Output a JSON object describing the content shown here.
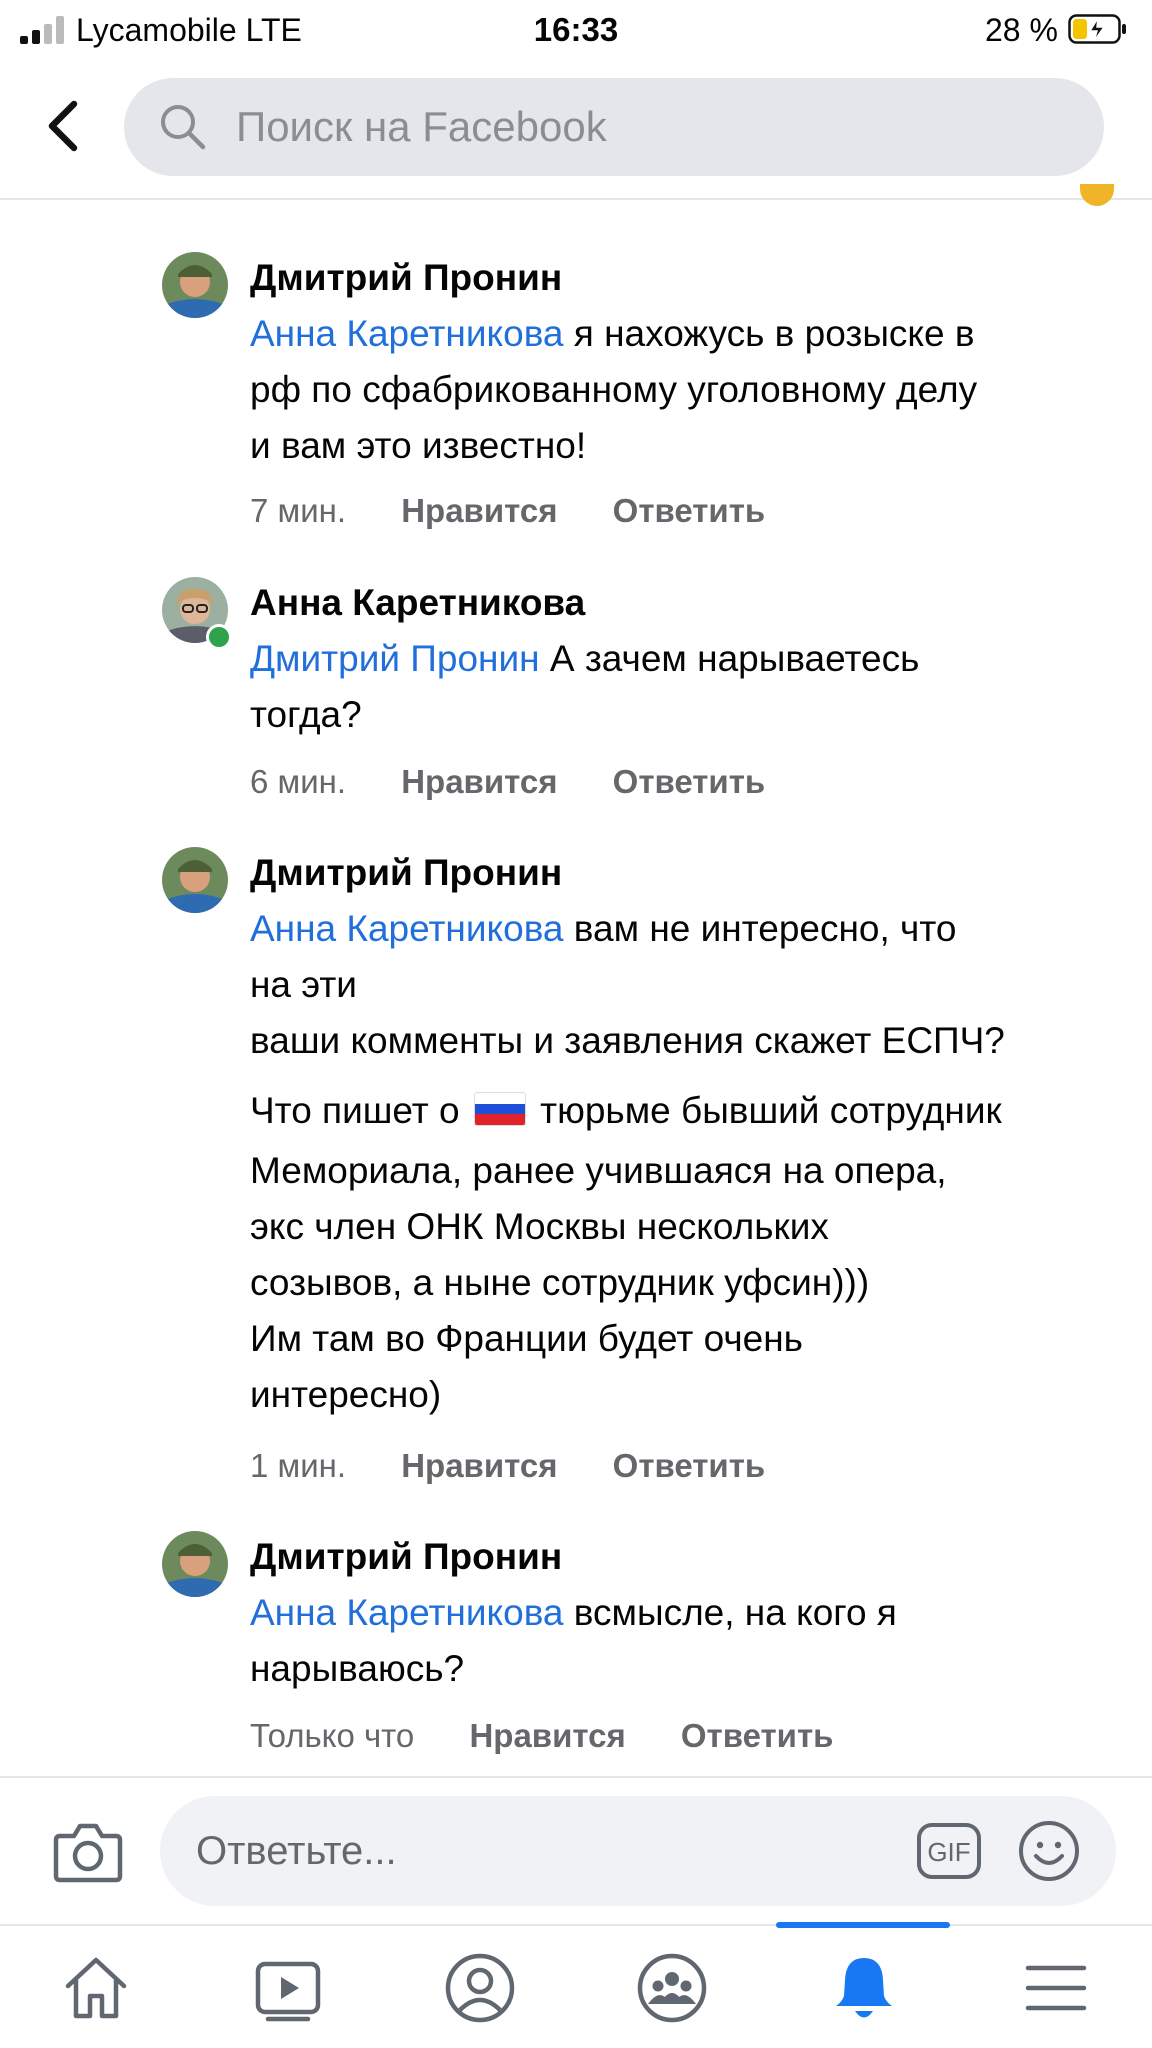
{
  "status_bar": {
    "carrier": "Lycamobile  LTE",
    "time": "16:33",
    "battery": "28 %",
    "battery_level": 0.28
  },
  "header": {
    "search_placeholder": "Поиск на Facebook"
  },
  "comments": [
    {
      "author": "Дмитрий Пронин",
      "lines": [
        {
          "mention": "Анна Каретникова",
          "text": " я нахожусь в розыске в"
        },
        {
          "text": "рф по сфабрикованному уголовному делу"
        },
        {
          "text": "и вам это известно!"
        }
      ],
      "time": "7 мин.",
      "like": "Нравится",
      "reply": "Ответить"
    },
    {
      "author": "Анна Каретникова",
      "online": true,
      "lines": [
        {
          "mention": "Дмитрий Пронин",
          "text": " А зачем нарываетесь"
        },
        {
          "text": "тогда?"
        }
      ],
      "time": "6 мин.",
      "like": "Нравится",
      "reply": "Ответить"
    },
    {
      "author": "Дмитрий Пронин",
      "lines": [
        {
          "mention": "Анна Каретникова",
          "text": " вам не интересно, что"
        },
        {
          "text": "на эти"
        },
        {
          "text": "ваши комменты и заявления скажет ЕСПЧ?"
        },
        {
          "text": "Что пишет о",
          "flag": "russia-flag",
          "after": " тюрьме бывший сотрудник"
        },
        {
          "text": "Мемориала, ранее учившаяся на опера,"
        },
        {
          "text": "экс член ОНК Москвы нескольких"
        },
        {
          "text": "созывов, а ныне сотрудник уфсин)))"
        },
        {
          "text": "Им там во Франции будет очень"
        },
        {
          "text": "интересно)"
        }
      ],
      "time": "1 мин.",
      "like": "Нравится",
      "reply": "Ответить"
    },
    {
      "author": "Дмитрий Пронин",
      "lines": [
        {
          "mention": "Анна Каретникова",
          "text": " всмысле, на кого я"
        },
        {
          "text": "нарываюсь?"
        }
      ],
      "time": "Только что",
      "like": "Нравится",
      "reply": "Ответить"
    }
  ],
  "reply_bar": {
    "placeholder": "Ответьте...",
    "gif_label": "GIF"
  },
  "tab_bar": {
    "tabs": [
      "home-icon",
      "watch-icon",
      "profile-icon",
      "groups-icon",
      "notifications-icon",
      "menu-icon"
    ],
    "active": "notifications-icon"
  },
  "colors": {
    "mention": "#216fdb",
    "active_tab": "#1877f2",
    "meta": "#65676b"
  }
}
